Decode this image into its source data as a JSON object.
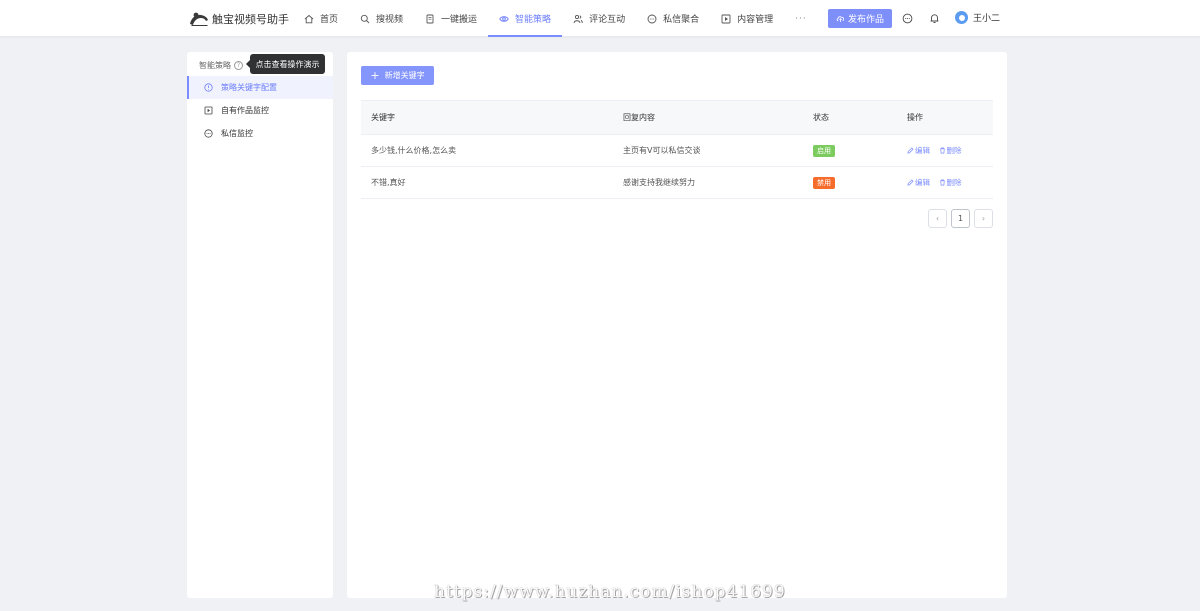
{
  "app": {
    "title": "触宝视频号助手"
  },
  "nav": {
    "items": [
      {
        "label": "首页",
        "icon": "home-icon"
      },
      {
        "label": "搜视频",
        "icon": "search-icon"
      },
      {
        "label": "一键搬运",
        "icon": "phone-icon"
      },
      {
        "label": "智能策略",
        "icon": "eye-icon",
        "active": true
      },
      {
        "label": "评论互动",
        "icon": "people-icon"
      },
      {
        "label": "私信聚合",
        "icon": "chat-icon"
      },
      {
        "label": "内容管理",
        "icon": "play-icon"
      }
    ],
    "more_label": "···"
  },
  "header": {
    "publish_label": "发布作品",
    "user_name": "王小二"
  },
  "sidebar": {
    "title": "智能策略",
    "help_glyph": "?",
    "tooltip": "点击查看操作演示",
    "items": [
      {
        "label": "策略关键字配置",
        "icon": "info-circle-icon",
        "active": true
      },
      {
        "label": "自有作品监控",
        "icon": "play-square-icon"
      },
      {
        "label": "私信监控",
        "icon": "chat-icon"
      }
    ]
  },
  "main": {
    "add_label": "新增关键字",
    "table": {
      "headers": [
        "关键字",
        "回复内容",
        "状态",
        "操作"
      ],
      "rows": [
        {
          "keyword": "多少钱,什么价格,怎么卖",
          "reply": "主页有V可以私信交谈",
          "status": "启用",
          "status_color": "#7ccb5e"
        },
        {
          "keyword": "不错,真好",
          "reply": "感谢支持我继续努力",
          "status": "禁用",
          "status_color": "#f56c2d"
        }
      ],
      "edit_label": "编辑",
      "delete_label": "删除"
    },
    "pager": {
      "prev": "‹",
      "current": "1",
      "next": "›"
    }
  },
  "watermark": "https://www.huzhan.com/ishop41699",
  "colors": {
    "accent": "#7b8cff",
    "enabled": "#7ccb5e",
    "disabled": "#f56c2d"
  }
}
